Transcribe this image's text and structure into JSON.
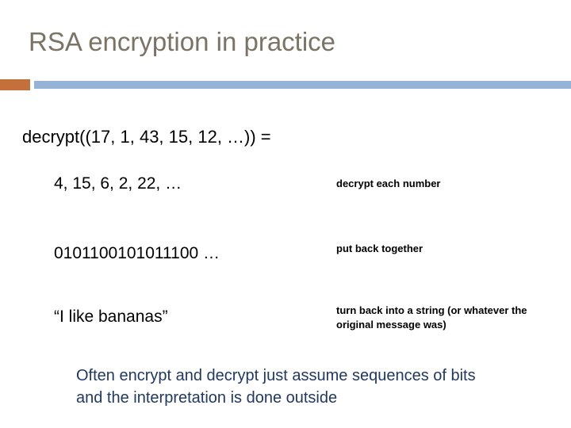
{
  "slide": {
    "title": "RSA encryption in practice",
    "accent_color": "#c3703a",
    "rule_color": "#95b3d7",
    "title_color": "#7b7363",
    "main_line": "decrypt((17, 1, 43, 15, 12, …)) =",
    "steps": [
      {
        "value": "4, 15, 6, 2, 22, …",
        "note": "decrypt each number"
      },
      {
        "value": "0101100101011100 …",
        "note": "put back together"
      },
      {
        "value": "“I like bananas”",
        "note": "turn back into a string (or whatever the original message was)"
      }
    ],
    "closing_text": "Often encrypt and decrypt just assume sequences of bits and the interpretation is done outside",
    "closing_color": "#1f3864"
  }
}
